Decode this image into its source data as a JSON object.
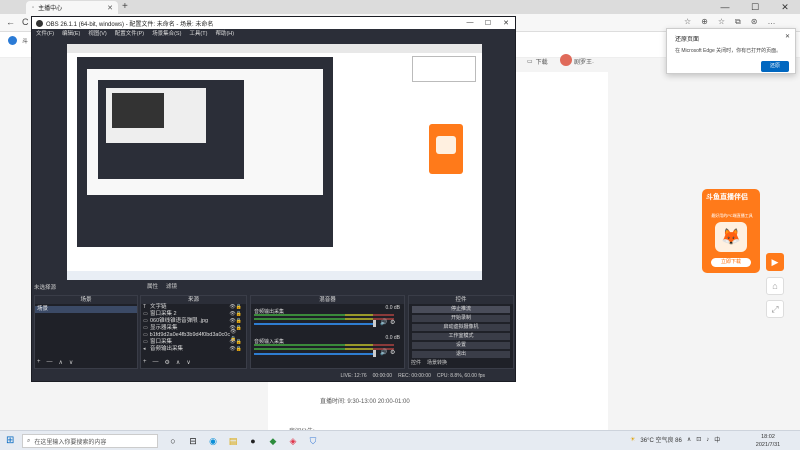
{
  "browser": {
    "tab_title": "主播中心",
    "tab_close": "✕",
    "new_tab": "+",
    "window_controls": [
      "—",
      "☐",
      "✕"
    ],
    "back": "←",
    "refresh": "C",
    "toolbar_icons": [
      "☆",
      "⊕",
      "☆",
      "⧉",
      "⊛",
      "…"
    ]
  },
  "site": {
    "header_text": "斗",
    "download_label": "下载",
    "user_name": "剧罗王·",
    "notice_label": "房间公告:",
    "notice_time": "直播时间: 9:30-13:00 20:00-01:00"
  },
  "promo": {
    "title": "斗鱼直播伴侣",
    "subtitle": "最好用的PC端直播工具",
    "button": "立即下载"
  },
  "side_buttons": {
    "play": "▶",
    "home": "⌂",
    "expand": "⤢"
  },
  "edge_popup": {
    "title": "还原页面",
    "body": "在 Microsoft Edge 关闭时，你有已打开的页面。",
    "close": "✕",
    "button": "还原"
  },
  "obs": {
    "title": "OBS 26.1.1 (64-bit, windows) - 配置文件: 未命名 - 场景: 未命名",
    "win_controls": [
      "—",
      "☐",
      "✕"
    ],
    "menu": [
      "文件(F)",
      "编辑(E)",
      "视图(V)",
      "配置文件(P)",
      "场景集合(S)",
      "工具(T)",
      "帮助(H)"
    ],
    "no_source": "未选择源",
    "mode_buttons": [
      "属性",
      "滤镜"
    ],
    "scenes": {
      "title": "场景",
      "items": [
        "场景"
      ],
      "footer": [
        "+",
        "—",
        "∧",
        "∨"
      ]
    },
    "sources": {
      "title": "来源",
      "items": [
        {
          "icon": "T",
          "label": "文字链"
        },
        {
          "icon": "▭",
          "label": "窗口采集 2"
        },
        {
          "icon": "▭",
          "label": "060锥线锥语音弹限 .jpg"
        },
        {
          "icon": "▭",
          "label": "显示器采集"
        },
        {
          "icon": "▭",
          "label": "b1fd9d2a0e4fb3b9d4f0bd3a0c0c"
        },
        {
          "icon": "▭",
          "label": "窗口采集"
        },
        {
          "icon": "◂",
          "label": "音频输出采集"
        }
      ],
      "footer": [
        "+",
        "—",
        "⚙",
        "∧",
        "∨"
      ]
    },
    "mixer": {
      "title": "混音器",
      "channels": [
        {
          "name": "音频输出采集",
          "db": "0.0 dB"
        },
        {
          "name": "音频输入采集",
          "db": "0.0 dB"
        }
      ]
    },
    "controls": {
      "title": "控件",
      "buttons": [
        "停止推流",
        "开始录制",
        "启动虚拟摄像机",
        "工作室模式",
        "设置",
        "退出"
      ],
      "tabs": [
        "控件",
        "场景转换"
      ]
    },
    "status": [
      "LIVE: 12:76",
      "00:00:00",
      "REC: 00:00:00",
      "CPU: 8.8%, 60.00 fps"
    ]
  },
  "taskbar": {
    "start": "⊞",
    "search_icon": "⌕",
    "search_placeholder": "在这里输入你要搜索的内容",
    "apps": [
      "○",
      "⊟",
      "◉",
      "▤",
      "●",
      "◆",
      "◈",
      "⛉"
    ],
    "weather": "36°C 空气良 86",
    "tray_icons": [
      "∧",
      "⊡",
      "♪",
      "中"
    ],
    "time": "18:02",
    "date": "2021/7/31"
  }
}
